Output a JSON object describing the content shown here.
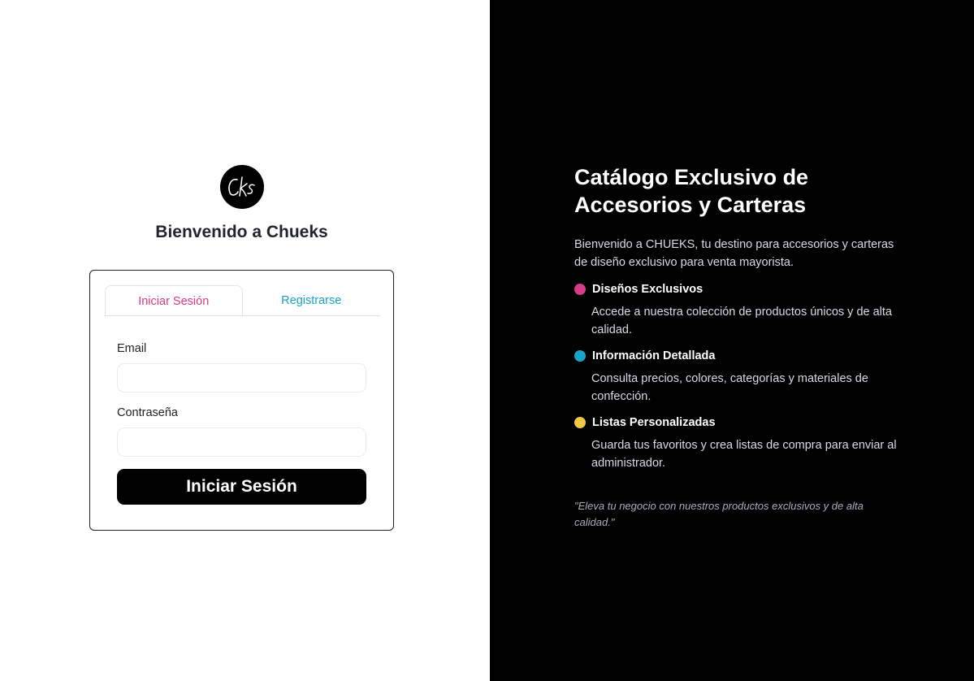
{
  "login": {
    "logo_text": "Cks",
    "welcome": "Bienvenido a Chueks",
    "tabs": [
      {
        "label": "Iniciar Sesión",
        "active": true
      },
      {
        "label": "Registrarse",
        "active": false
      }
    ],
    "email_label": "Email",
    "email_value": "",
    "password_label": "Contraseña",
    "password_value": "",
    "submit_label": "Iniciar Sesión"
  },
  "promo": {
    "title": "Catálogo Exclusivo de Accesorios y Carteras",
    "intro": "Bienvenido a CHUEKS, tu destino para accesorios y carteras de diseño exclusivo para venta mayorista.",
    "features": [
      {
        "title": "Diseños Exclusivos",
        "desc": "Accede a nuestra colección de productos únicos y de alta calidad.",
        "color": "#d63b85"
      },
      {
        "title": "Información Detallada",
        "desc": "Consulta precios, colores, categorías y materiales de confección.",
        "color": "#1aa3c8"
      },
      {
        "title": "Listas Personalizadas",
        "desc": "Guarda tus favoritos y crea listas de compra para enviar al administrador.",
        "color": "#f2c744"
      }
    ],
    "quote": "\"Eleva tu negocio con nuestros productos exclusivos y de alta calidad.\""
  },
  "colors": {
    "accent_pink": "#d63b85",
    "accent_cyan": "#1aa3c8",
    "accent_yellow": "#f2c744"
  }
}
